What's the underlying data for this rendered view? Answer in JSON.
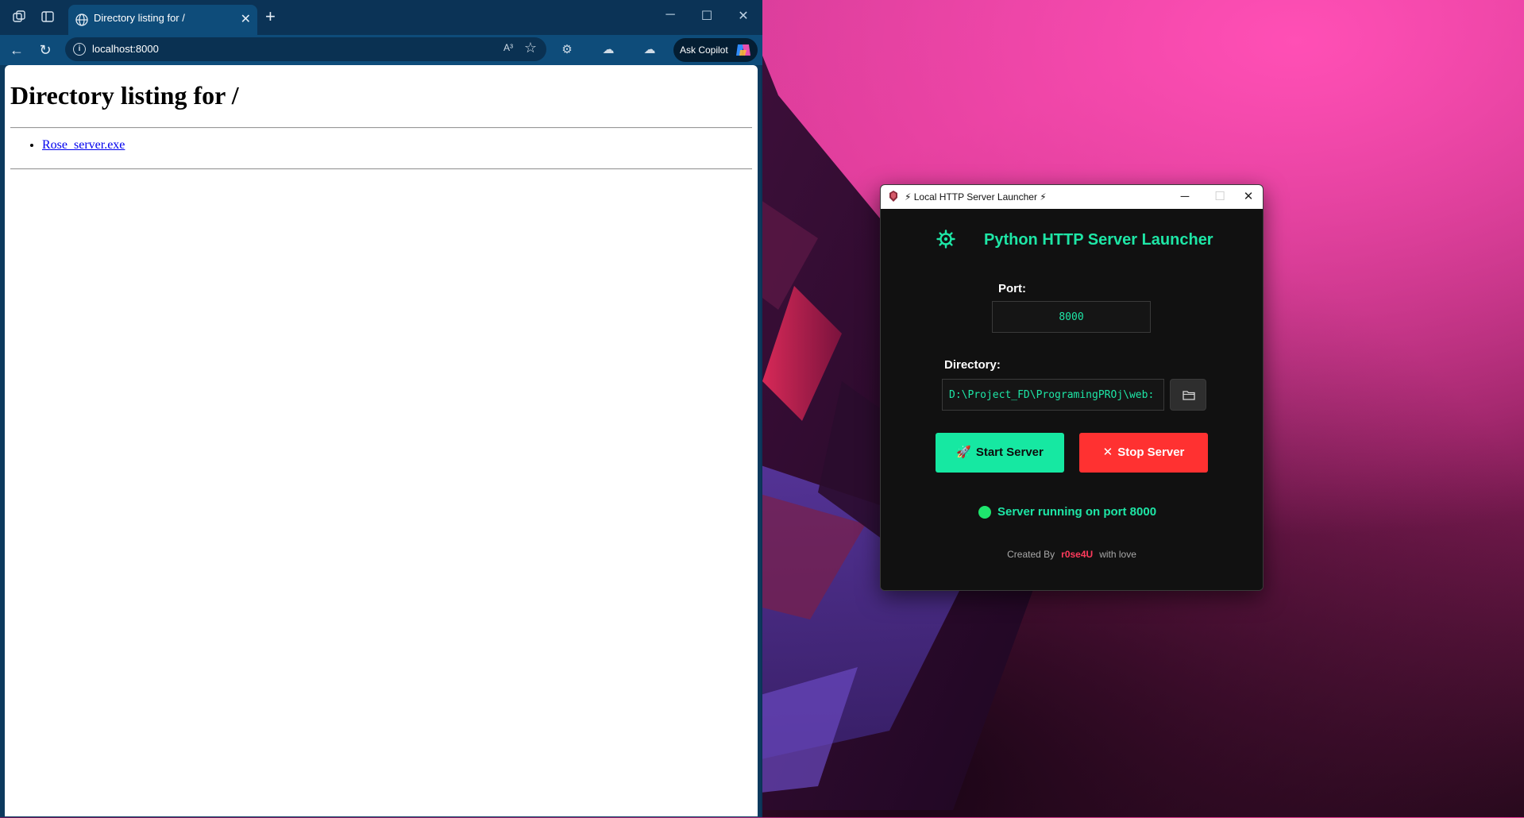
{
  "browser": {
    "tab_title": "Directory listing for /",
    "address": "localhost:8000",
    "read_aloud_glyph": "A³",
    "copilot_label": "Ask Copilot",
    "icons": [
      "workspaces-icon",
      "tab-actions-icon",
      "globe-icon",
      "close-icon",
      "new-tab-icon",
      "back-icon",
      "refresh-icon",
      "info-icon",
      "read-aloud-icon",
      "favorite-star-icon",
      "extensions-icon",
      "copilot-icon"
    ]
  },
  "page": {
    "heading": "Directory listing for /",
    "files": [
      {
        "name": "Rose_server.exe"
      }
    ]
  },
  "launcher": {
    "window_title": "⚡ Local HTTP Server Launcher ⚡",
    "heading": "Python HTTP Server Launcher",
    "port_label": "Port:",
    "port_value": "8000",
    "directory_label": "Directory:",
    "directory_value": "D:\\Project_FD\\ProgramingPROj\\web:",
    "start_label": "Start Server",
    "stop_label": "Stop Server",
    "status_text": "Server running on port 8000",
    "credit_prefix": "Created By",
    "credit_name": "r0se4U",
    "credit_suffix": "with love",
    "colors": {
      "accent": "#1ee6a6",
      "start_button": "#16e8a2",
      "stop_button": "#ff3131",
      "status_dot": "#1ee66e",
      "credit_name": "#ff3b5c",
      "background": "#111111"
    }
  }
}
